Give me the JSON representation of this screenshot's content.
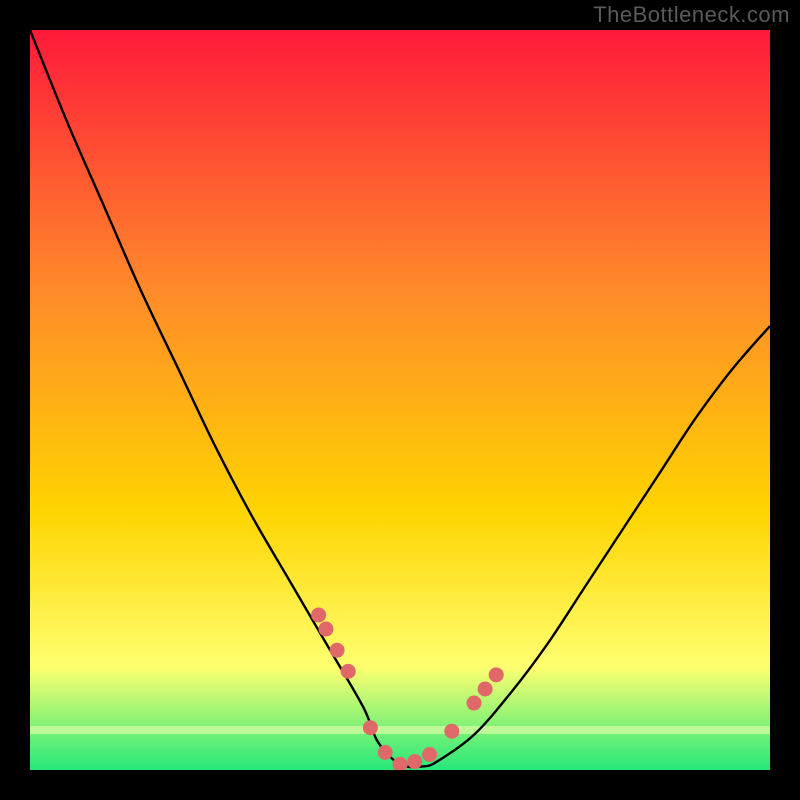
{
  "watermark": "TheBottleneck.com",
  "colors": {
    "black": "#000000",
    "gradient_top": "#ff1a3a",
    "gradient_mid1": "#ff6a2a",
    "gradient_mid2": "#ffd400",
    "gradient_mid3": "#ffff70",
    "gradient_bottom": "#25e87a",
    "curve": "#000000",
    "dot": "#e06868"
  },
  "chart_data": {
    "type": "line",
    "title": "",
    "xlabel": "",
    "ylabel": "",
    "xlim": [
      0,
      100
    ],
    "ylim": [
      0,
      105
    ],
    "series": [
      {
        "name": "bottleneck-curve",
        "x": [
          0,
          5,
          10,
          15,
          20,
          25,
          30,
          35,
          40,
          45,
          47,
          50,
          53,
          55,
          60,
          65,
          70,
          75,
          80,
          85,
          90,
          95,
          100
        ],
        "y": [
          105,
          92,
          80,
          68,
          57,
          46,
          36,
          27,
          18,
          9,
          4,
          0.8,
          0.5,
          1.2,
          5,
          11,
          18,
          26,
          34,
          42,
          50,
          57,
          63
        ]
      }
    ],
    "markers": {
      "name": "highlight-dots",
      "x": [
        39,
        40,
        41.5,
        43,
        46,
        48,
        50,
        52,
        54,
        57,
        60,
        61.5,
        63
      ],
      "y": [
        22,
        20,
        17,
        14,
        6,
        2.5,
        0.8,
        1.2,
        2.2,
        5.5,
        9.5,
        11.5,
        13.5
      ]
    }
  }
}
